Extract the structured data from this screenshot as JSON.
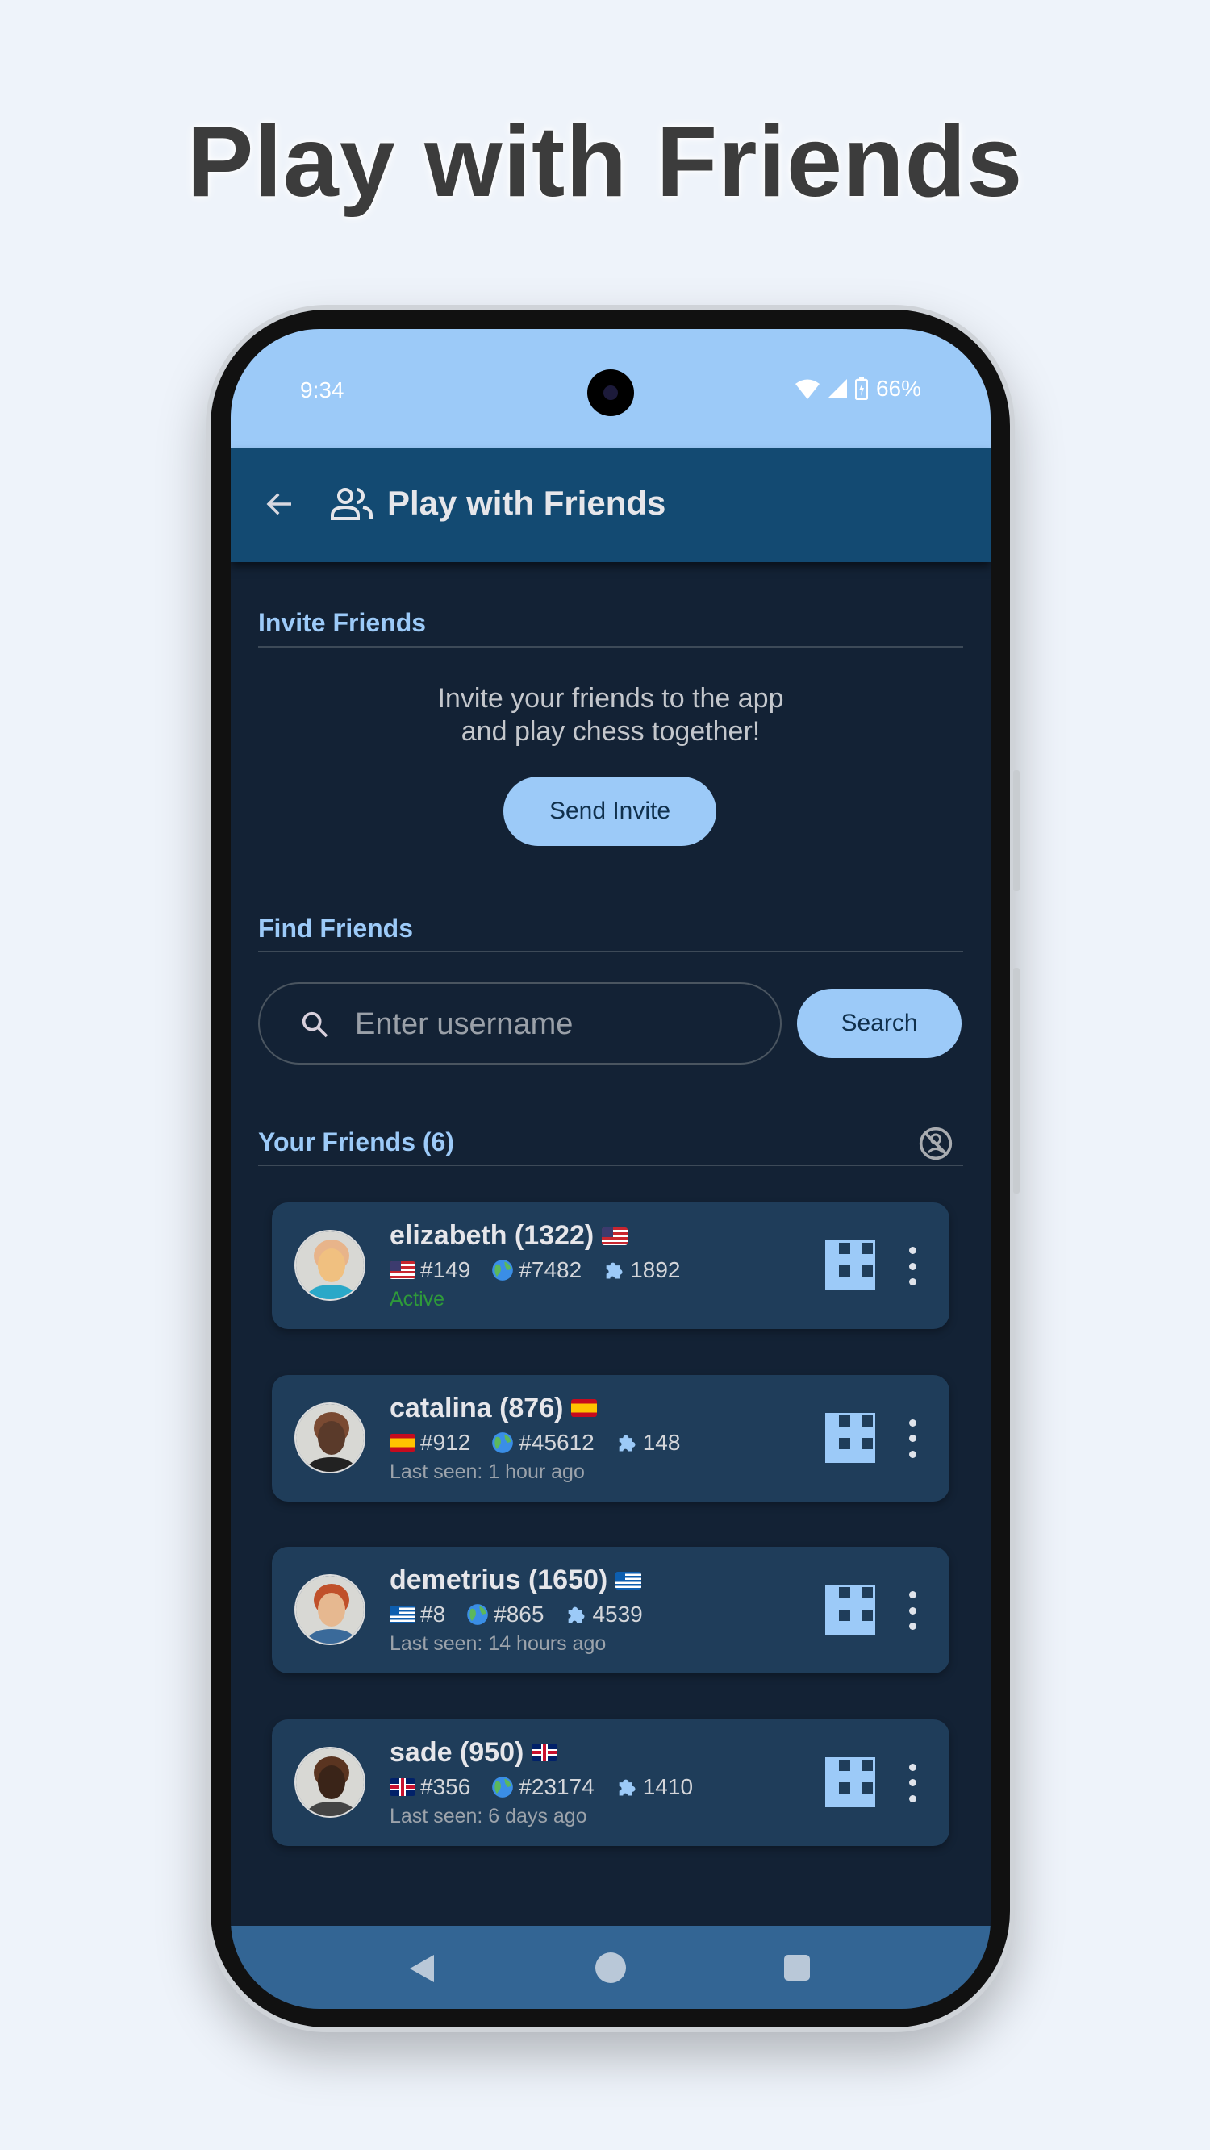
{
  "headline": "Play with Friends",
  "status_bar": {
    "time": "9:34",
    "battery": "66%",
    "icons": [
      "wifi-icon",
      "signal-icon",
      "battery-charging-icon"
    ]
  },
  "app_bar": {
    "title": "Play with Friends",
    "back_icon": "arrow-left-icon",
    "title_icon": "people-icon"
  },
  "invite": {
    "heading": "Invite Friends",
    "line1": "Invite your friends to the app",
    "line2": "and play chess together!",
    "button": "Send Invite"
  },
  "find": {
    "heading": "Find Friends",
    "placeholder": "Enter username",
    "value": "",
    "button": "Search"
  },
  "friends": {
    "heading": "Your Friends (6)",
    "heading_icon": "person-off-icon",
    "items": [
      {
        "name": "elizabeth (1322)",
        "flag": "us",
        "country_rank": "#149",
        "world_rank": "#7482",
        "puzzle": "1892",
        "status": "Active",
        "active": true
      },
      {
        "name": "catalina (876)",
        "flag": "es",
        "country_rank": "#912",
        "world_rank": "#45612",
        "puzzle": "148",
        "status": "Last seen: 1 hour ago",
        "active": false
      },
      {
        "name": "demetrius (1650)",
        "flag": "gr",
        "country_rank": "#8",
        "world_rank": "#865",
        "puzzle": "4539",
        "status": "Last seen: 14 hours ago",
        "active": false
      },
      {
        "name": "sade (950)",
        "flag": "gb",
        "country_rank": "#356",
        "world_rank": "#23174",
        "puzzle": "1410",
        "status": "Last seen: 6 days ago",
        "active": false
      }
    ]
  },
  "colors": {
    "accent": "#9ccaf8",
    "app_bar": "#134a72",
    "background": "#132235",
    "card": "#1f3d5a",
    "active": "#2e9a3a",
    "nav_bar": "#336594"
  }
}
